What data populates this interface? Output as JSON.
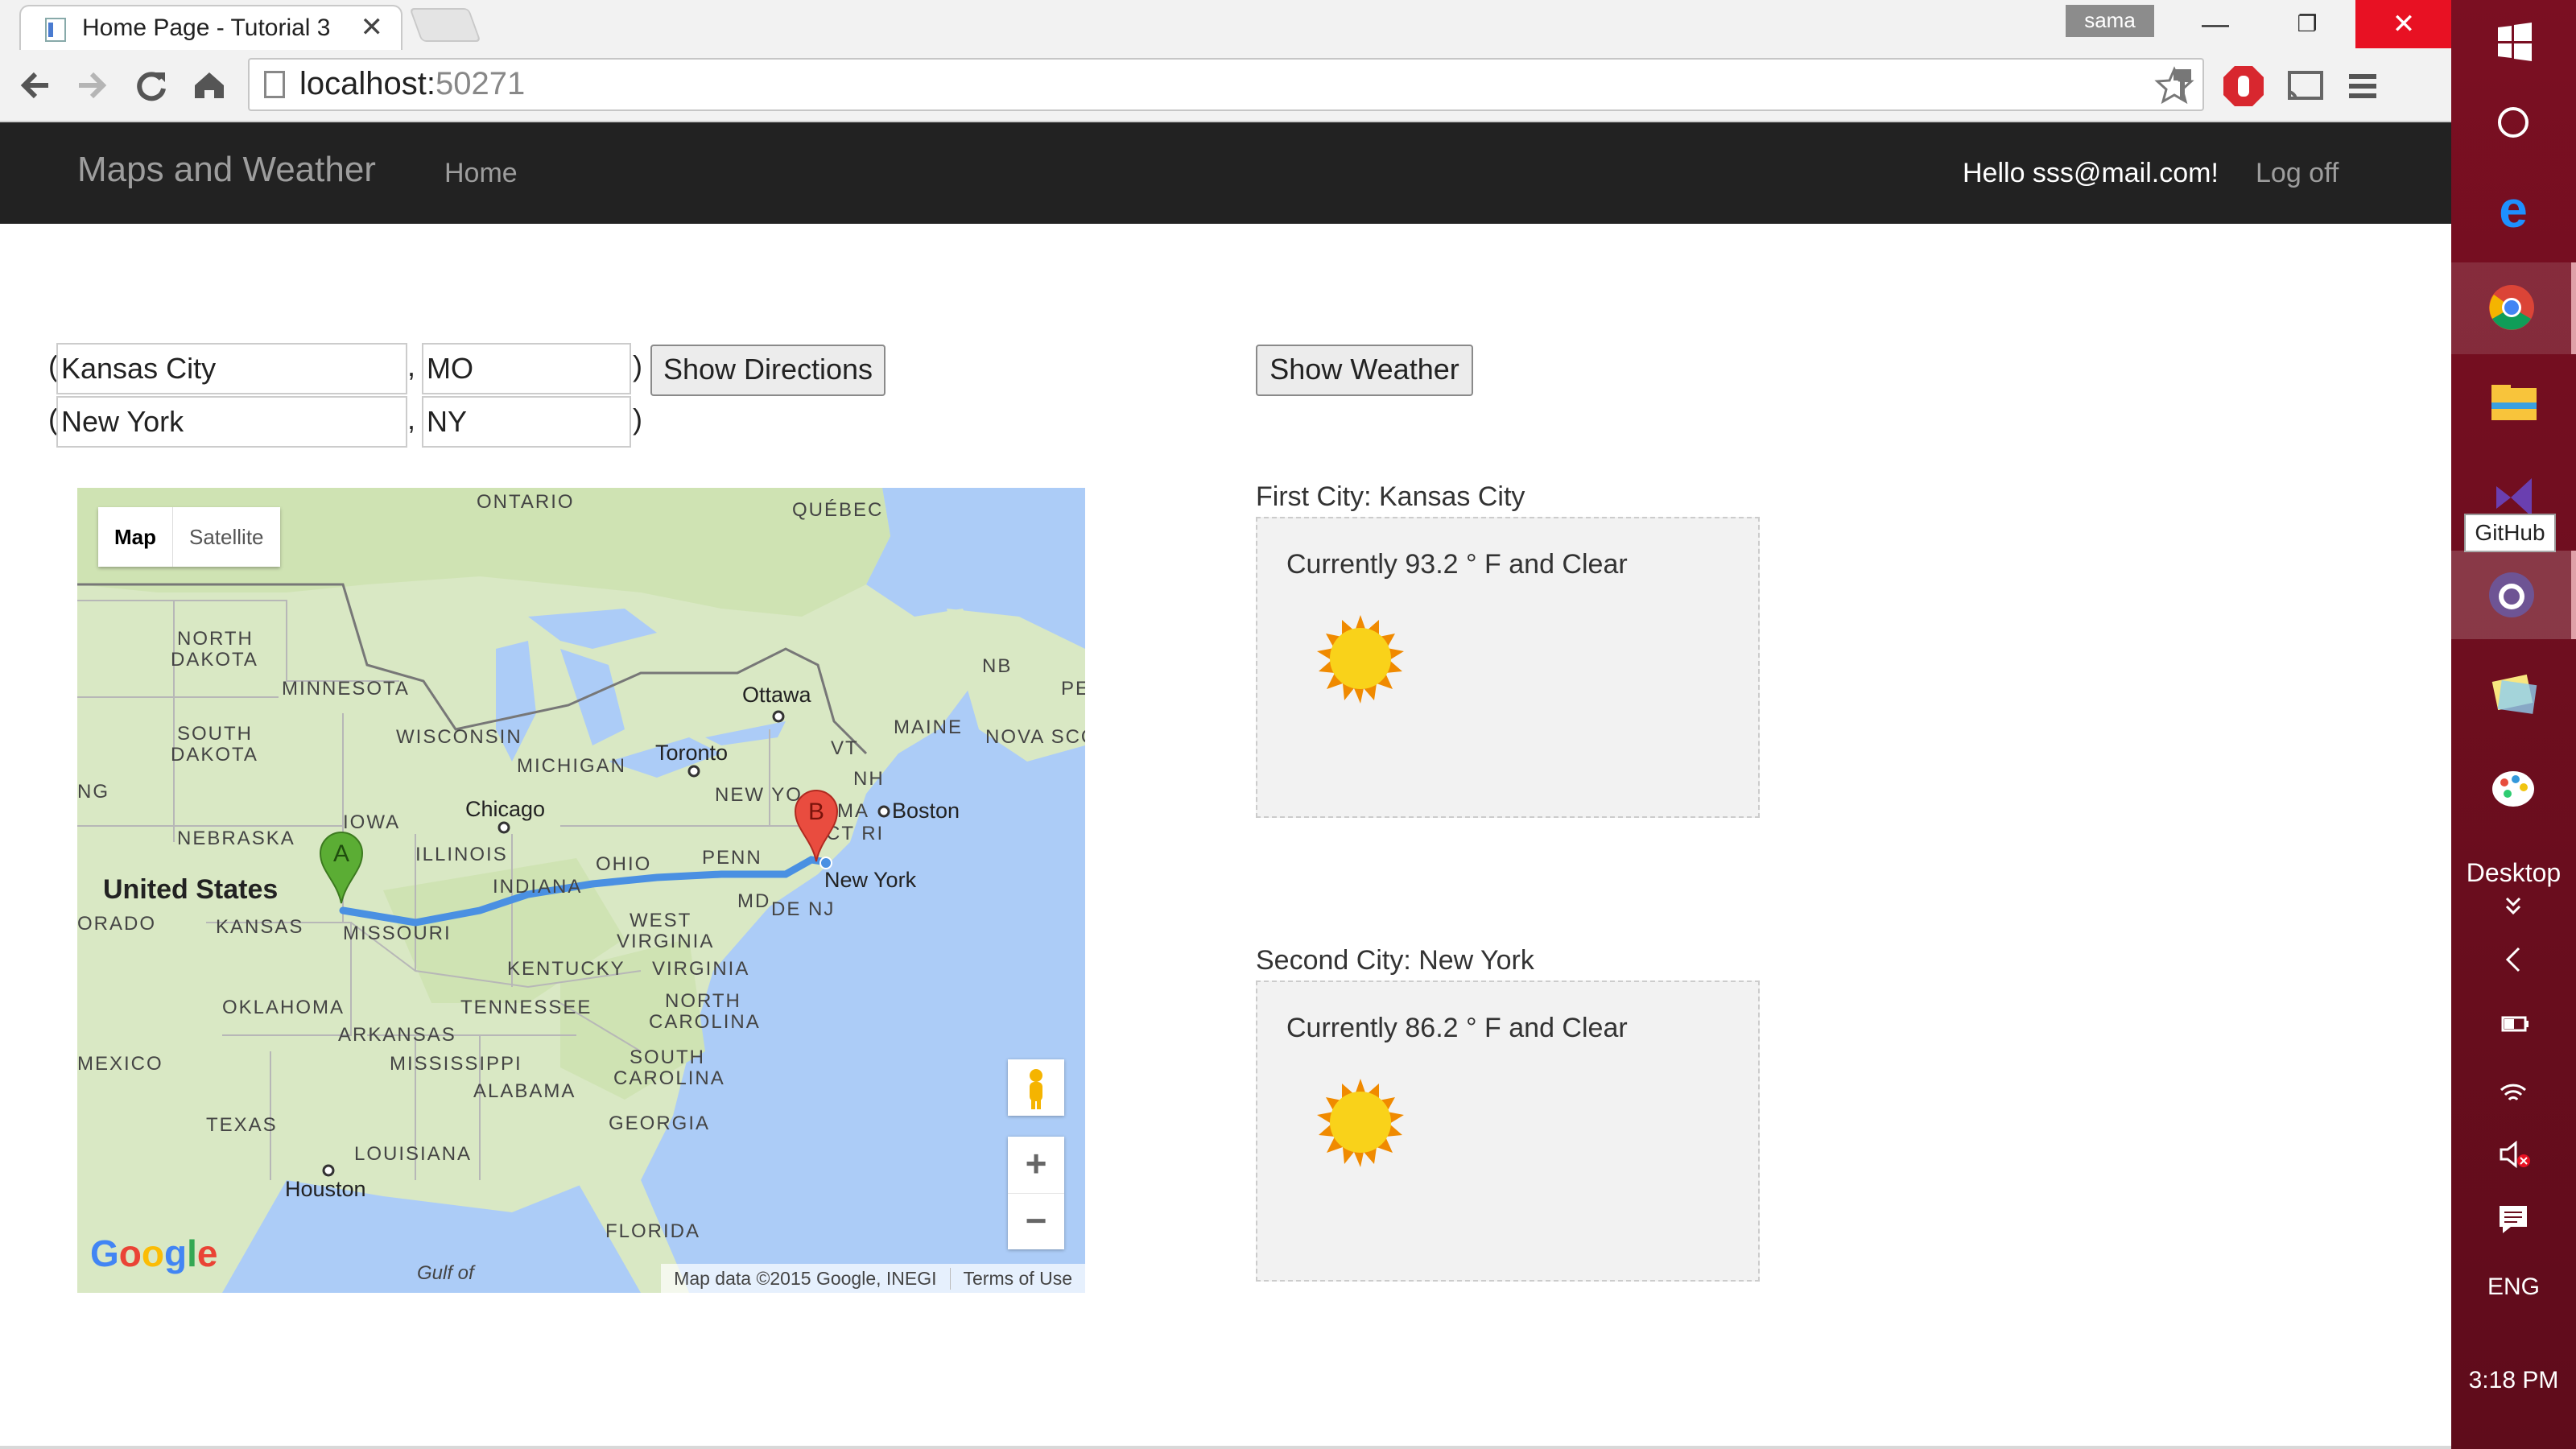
{
  "browser": {
    "tab_title": "Home Page - Tutorial 3",
    "tab_close": "✕",
    "user_badge": "sama",
    "url_host": "localhost:",
    "url_port": "50271",
    "win_minimize": "—",
    "win_restore": "❐",
    "win_close": "✕"
  },
  "navbar": {
    "brand": "Maps and Weather",
    "home": "Home",
    "hello": "Hello sss@mail.com!",
    "logoff": "Log off"
  },
  "form": {
    "city1": "Kansas City",
    "state1": "MO",
    "city2": "New York",
    "state2": "NY",
    "show_directions": "Show Directions",
    "show_weather": "Show Weather",
    "open_paren": "(",
    "close_paren": ")",
    "comma": ","
  },
  "map": {
    "type_map": "Map",
    "type_satellite": "Satellite",
    "zoom_in": "+",
    "zoom_out": "−",
    "attribution": "Map data ©2015 Google, INEGI",
    "terms": "Terms of Use",
    "logo": "Google",
    "marker_a": "A",
    "marker_b": "B",
    "labels": {
      "ontario": "ONTARIO",
      "quebec": "QUÉBEC",
      "north_dakota_1": "NORTH",
      "north_dakota_2": "DAKOTA",
      "minnesota": "MINNESOTA",
      "south_dakota_1": "SOUTH",
      "south_dakota_2": "DAKOTA",
      "wisconsin": "WISCONSIN",
      "michigan": "MICHIGAN",
      "ottawa": "Ottawa",
      "nb": "NB",
      "pe": "PE",
      "maine": "MAINE",
      "nova_scotia": "NOVA SCO",
      "vt": "VT",
      "nh": "NH",
      "toronto": "Toronto",
      "new_york_state": "NEW YO",
      "ma": "MA",
      "boston": "Boston",
      "ct_ri": "CT RI",
      "ng": "NG",
      "iowa": "IOWA",
      "chicago": "Chicago",
      "nebraska": "NEBRASKA",
      "illinois": "ILLINOIS",
      "ohio": "OHIO",
      "penn": "PENN",
      "united_states": "United States",
      "indiana": "INDIANA",
      "md": "MD",
      "de_nj": "DE NJ",
      "new_york_city": "New York",
      "orado": "ORADO",
      "kansas": "KANSAS",
      "missouri": "MISSOURI",
      "west_virginia_1": "WEST",
      "west_virginia_2": "VIRGINIA",
      "kentucky": "KENTUCKY",
      "virginia": "VIRGINIA",
      "oklahoma": "OKLAHOMA",
      "tennessee": "TENNESSEE",
      "north_carolina_1": "NORTH",
      "north_carolina_2": "CAROLINA",
      "arkansas": "ARKANSAS",
      "mexico": "MEXICO",
      "mississippi": "MISSISSIPPI",
      "south_carolina_1": "SOUTH",
      "south_carolina_2": "CAROLINA",
      "alabama": "ALABAMA",
      "georgia": "GEORGIA",
      "texas": "TEXAS",
      "louisiana": "LOUISIANA",
      "houston": "Houston",
      "florida": "FLORIDA",
      "gulf_of": "Gulf of"
    }
  },
  "weather": {
    "first_label": "First City: Kansas City",
    "first_current": "Currently 93.2 ° F and Clear",
    "second_label": "Second City: New York",
    "second_current": "Currently 86.2 ° F and Clear"
  },
  "taskbar": {
    "github_tooltip": "GitHub",
    "desktop": "Desktop",
    "language": "ENG",
    "time": "3:18 PM"
  },
  "colors": {
    "navbar_bg": "#222222",
    "taskbar_bg": "#7b0f22",
    "route": "#4a90e2",
    "marker_a": "#5bad34",
    "marker_b": "#e94c3f",
    "sun": "#f9d21a"
  }
}
